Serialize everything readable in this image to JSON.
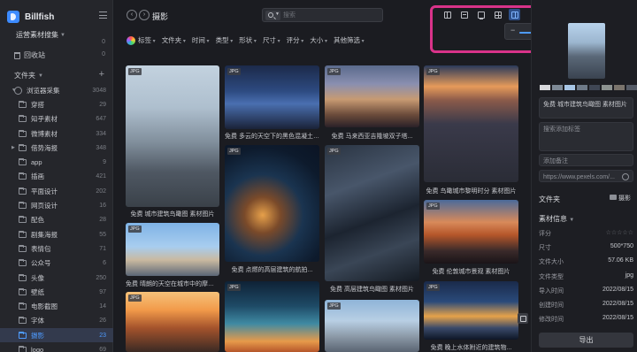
{
  "app": {
    "name": "Billfish"
  },
  "sidebar": {
    "library_name": "运营素材搜集",
    "library_sub": "",
    "library_sub_count": "0",
    "recycle_label": "回收站",
    "recycle_count": "0",
    "folders_label": "文件夹",
    "folders": [
      {
        "name": "浏览器采集",
        "count": "3048",
        "root": true,
        "caret": "▼"
      },
      {
        "name": "穿搭",
        "count": "29"
      },
      {
        "name": "知乎素材",
        "count": "647"
      },
      {
        "name": "微博素材",
        "count": "334"
      },
      {
        "name": "借势海报",
        "count": "348",
        "caret": "▶"
      },
      {
        "name": "app",
        "count": "9"
      },
      {
        "name": "插画",
        "count": "421"
      },
      {
        "name": "平面设计",
        "count": "202"
      },
      {
        "name": "网页设计",
        "count": "16"
      },
      {
        "name": "配色",
        "count": "28"
      },
      {
        "name": "剧集海报",
        "count": "55"
      },
      {
        "name": "表情包",
        "count": "71"
      },
      {
        "name": "公众号",
        "count": "6"
      },
      {
        "name": "头像",
        "count": "250"
      },
      {
        "name": "壁纸",
        "count": "97"
      },
      {
        "name": "电影截图",
        "count": "14"
      },
      {
        "name": "字体",
        "count": "26"
      },
      {
        "name": "摄影",
        "count": "23",
        "active": true
      },
      {
        "name": "logo",
        "count": "69"
      }
    ]
  },
  "toolbar": {
    "back": "‹",
    "forward": "›",
    "title": "摄影",
    "search_placeholder": "搜索",
    "zoom_level": 0.55,
    "minimize": "—",
    "maximize": "☐",
    "close": "✕"
  },
  "filters": [
    "标签",
    "文件夹",
    "时间",
    "类型",
    "形状",
    "尺寸",
    "评分",
    "大小",
    "其他筛选"
  ],
  "grid": {
    "tag": "JPG",
    "captions": [
      "免费 城市建筑鸟瞰图 素材图片",
      "免费 多云的天空下的黑色混凝土建...",
      "免费 马来西亚吉隆坡双子塔...",
      "免费 鸟瞰城市黎明时分 素材图片",
      "免费 高层建筑鸟瞰图 素材图片",
      "免费 点燃的高层建筑的航拍...",
      "免费 伦敦城市景观 素材图片",
      "免费 晴朗的天空在城市中的摩天大...",
      "免费 晚上水体附近的建筑物..."
    ]
  },
  "panel": {
    "name_value": "免费 城市建筑鸟瞰图 素材图片",
    "tag_placeholder": "搜索添加标签",
    "note_placeholder": "添加备注",
    "url_value": "https://www.pexels.com/...",
    "folder_label": "文件夹",
    "folder_value": "摄影",
    "info_label": "素材信息",
    "rows": [
      {
        "k": "评分",
        "v": ""
      },
      {
        "k": "尺寸",
        "v": "500*750"
      },
      {
        "k": "文件大小",
        "v": "57.06 KB"
      },
      {
        "k": "文件类型",
        "v": "jpg"
      },
      {
        "k": "导入时间",
        "v": "2022/08/15"
      },
      {
        "k": "创建时间",
        "v": "2022/08/15"
      },
      {
        "k": "修改时间",
        "v": "2022/08/15"
      }
    ],
    "stars": "☆☆☆☆☆",
    "export": "导出",
    "swatches": [
      "#d8d9dc",
      "#7e8a96",
      "#a8c6e6",
      "#6e7a88",
      "#3f4654",
      "#8c9290",
      "#7a746c",
      "#555b66"
    ]
  },
  "colors": {
    "accent": "#4e9bff",
    "highlight": "#d9338a"
  }
}
